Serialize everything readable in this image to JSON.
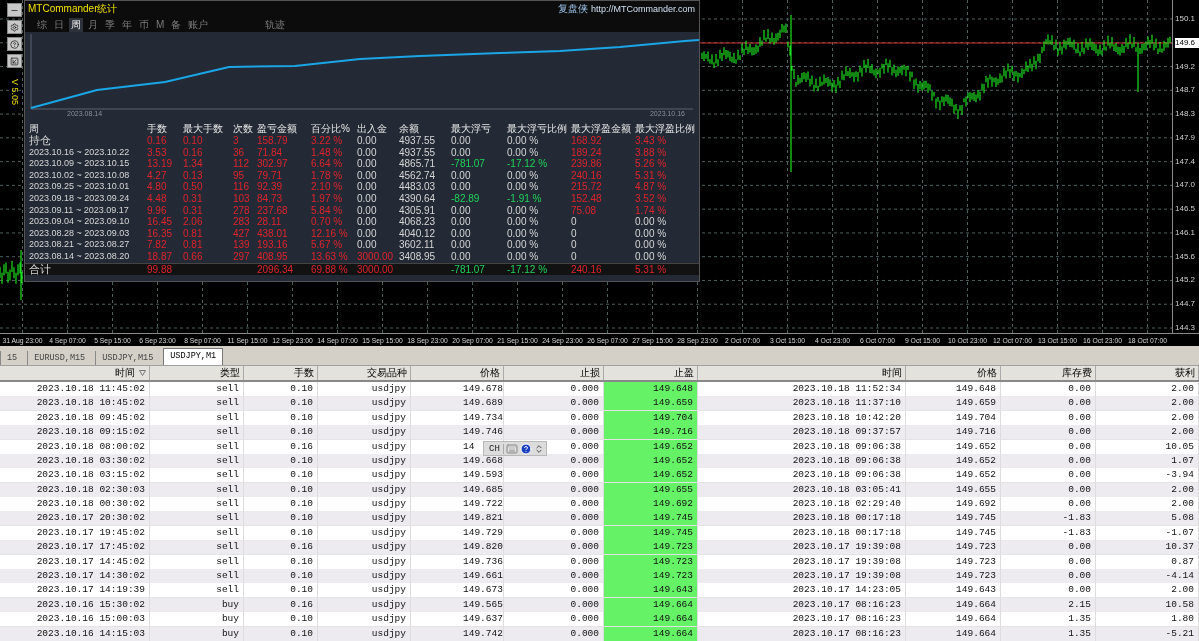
{
  "chart": {
    "price_ticks": [
      {
        "label": "150.1",
        "current": false
      },
      {
        "label": "149.6",
        "current": true
      },
      {
        "label": "149.2",
        "current": false
      },
      {
        "label": "148.7",
        "current": false
      },
      {
        "label": "148.3",
        "current": false
      },
      {
        "label": "147.9",
        "current": false
      },
      {
        "label": "147.4",
        "current": false
      },
      {
        "label": "147.0",
        "current": false
      },
      {
        "label": "146.5",
        "current": false
      },
      {
        "label": "146.1",
        "current": false
      },
      {
        "label": "145.6",
        "current": false
      },
      {
        "label": "145.2",
        "current": false
      },
      {
        "label": "144.7",
        "current": false
      },
      {
        "label": "144.3",
        "current": false
      }
    ],
    "time_labels": [
      "31 Aug 23:00",
      "4 Sep 07:00",
      "5 Sep 15:00",
      "6 Sep 23:00",
      "8 Sep 07:00",
      "11 Sep 15:00",
      "12 Sep 23:00",
      "14 Sep 07:00",
      "15 Sep 15:00",
      "18 Sep 23:00",
      "20 Sep 07:00",
      "21 Sep 15:00",
      "24 Sep 23:00",
      "26 Sep 07:00",
      "27 Sep 15:00",
      "28 Sep 23:00",
      "2 Oct 07:00",
      "3 Oct 15:00",
      "4 Oct 23:00",
      "6 Oct 07:00",
      "9 Oct 15:00",
      "10 Oct 23:00",
      "12 Oct 07:00",
      "13 Oct 15:00",
      "16 Oct 23:00",
      "18 Oct 07:00"
    ]
  },
  "stats_window": {
    "title": "MTCommander统计",
    "brand": "复盘侠",
    "url": "http://MTCommander.com",
    "version": "V 5.05",
    "tabs": [
      {
        "label": "综",
        "selected": false
      },
      {
        "label": "日",
        "selected": false
      },
      {
        "label": "周",
        "selected": true
      },
      {
        "label": "月",
        "selected": false
      },
      {
        "label": "季",
        "selected": false
      },
      {
        "label": "年",
        "selected": false
      },
      {
        "label": "币",
        "selected": false
      },
      {
        "label": "M",
        "selected": false
      },
      {
        "label": "备",
        "selected": false
      },
      {
        "label": "账户",
        "selected": false
      },
      {
        "label": "轨迹",
        "selected": false
      }
    ],
    "chart_start": "2023.08.14",
    "chart_end": "2023.10.16",
    "columns": [
      "周",
      "手数",
      "最大手数",
      "次数",
      "盈亏金额",
      "百分比%",
      "出入金",
      "余额",
      "最大浮亏",
      "最大浮亏比例",
      "最大浮盈金额",
      "最大浮盈比例"
    ],
    "rows": [
      {
        "kind": "holding",
        "floating_loss": false,
        "deposit": false,
        "floating_profit": true,
        "cells": [
          "持仓",
          "0.16",
          "0.10",
          "3",
          "158.79",
          "3.22 %",
          "0.00",
          "4937.55",
          "0.00",
          "0.00 %",
          "168.92",
          "3.43 %"
        ]
      },
      {
        "kind": "period",
        "floating_loss": false,
        "deposit": false,
        "floating_profit": true,
        "cells": [
          "2023.10.16 ~ 2023.10.22",
          "3.53",
          "0.16",
          "36",
          "71.84",
          "1.48 %",
          "0.00",
          "4937.55",
          "0.00",
          "0.00 %",
          "189.24",
          "3.88 %"
        ]
      },
      {
        "kind": "period",
        "floating_loss": true,
        "deposit": false,
        "floating_profit": true,
        "cells": [
          "2023.10.09 ~ 2023.10.15",
          "13.19",
          "1.34",
          "112",
          "302.97",
          "6.64 %",
          "0.00",
          "4865.71",
          "-781.07",
          "-17.12 %",
          "239.86",
          "5.26 %"
        ]
      },
      {
        "kind": "period",
        "floating_loss": false,
        "deposit": false,
        "floating_profit": true,
        "cells": [
          "2023.10.02 ~ 2023.10.08",
          "4.27",
          "0.13",
          "95",
          "79.71",
          "1.78 %",
          "0.00",
          "4562.74",
          "0.00",
          "0.00 %",
          "240.16",
          "5.31 %"
        ]
      },
      {
        "kind": "period",
        "floating_loss": false,
        "deposit": false,
        "floating_profit": true,
        "cells": [
          "2023.09.25 ~ 2023.10.01",
          "4.80",
          "0.50",
          "116",
          "92.39",
          "2.10 %",
          "0.00",
          "4483.03",
          "0.00",
          "0.00 %",
          "215.72",
          "4.87 %"
        ]
      },
      {
        "kind": "period",
        "floating_loss": true,
        "deposit": false,
        "floating_profit": true,
        "cells": [
          "2023.09.18 ~ 2023.09.24",
          "4.48",
          "0.31",
          "103",
          "84.73",
          "1.97 %",
          "0.00",
          "4390.64",
          "-82.89",
          "-1.91 %",
          "152.48",
          "3.52 %"
        ]
      },
      {
        "kind": "period",
        "floating_loss": false,
        "deposit": false,
        "floating_profit": true,
        "cells": [
          "2023.09.11 ~ 2023.09.17",
          "9.96",
          "0.31",
          "278",
          "237.68",
          "5.84 %",
          "0.00",
          "4305.91",
          "0.00",
          "0.00 %",
          "75.08",
          "1.74 %"
        ]
      },
      {
        "kind": "period",
        "floating_loss": false,
        "deposit": false,
        "floating_profit": false,
        "cells": [
          "2023.09.04 ~ 2023.09.10",
          "16.45",
          "2.06",
          "283",
          "28.11",
          "0.70 %",
          "0.00",
          "4068.23",
          "0.00",
          "0.00 %",
          "0",
          "0.00 %"
        ]
      },
      {
        "kind": "period",
        "floating_loss": false,
        "deposit": false,
        "floating_profit": false,
        "cells": [
          "2023.08.28 ~ 2023.09.03",
          "16.35",
          "0.81",
          "427",
          "438.01",
          "12.16 %",
          "0.00",
          "4040.12",
          "0.00",
          "0.00 %",
          "0",
          "0.00 %"
        ]
      },
      {
        "kind": "period",
        "floating_loss": false,
        "deposit": false,
        "floating_profit": false,
        "cells": [
          "2023.08.21 ~ 2023.08.27",
          "7.82",
          "0.81",
          "139",
          "193.16",
          "5.67 %",
          "0.00",
          "3602.11",
          "0.00",
          "0.00 %",
          "0",
          "0.00 %"
        ]
      },
      {
        "kind": "period",
        "floating_loss": false,
        "deposit": true,
        "floating_profit": false,
        "cells": [
          "2023.08.14 ~ 2023.08.20",
          "18.87",
          "0.66",
          "297",
          "408.95",
          "13.63 %",
          "3000.00",
          "3408.95",
          "0.00",
          "0.00 %",
          "0",
          "0.00 %"
        ]
      },
      {
        "kind": "total",
        "floating_loss": true,
        "deposit": true,
        "floating_profit": true,
        "cells": [
          "合计",
          "99.88",
          null,
          null,
          "2096.34",
          "69.88 %",
          "3000.00",
          null,
          "-781.07",
          "-17.12 %",
          "240.16",
          "5.31 %"
        ]
      }
    ]
  },
  "terminal": {
    "tabs": [
      {
        "label": "15",
        "selected": false
      },
      {
        "label": "EURUSD,M15",
        "selected": false
      },
      {
        "label": "USDJPY,M15",
        "selected": false
      },
      {
        "label": "USDJPY,M1",
        "selected": true
      }
    ],
    "columns": [
      {
        "label": "时间",
        "sorted": true
      },
      {
        "label": "类型",
        "sorted": false
      },
      {
        "label": "手数",
        "sorted": false
      },
      {
        "label": "交易品种",
        "sorted": false
      },
      {
        "label": "价格",
        "sorted": false
      },
      {
        "label": "止损",
        "sorted": false
      },
      {
        "label": "止盈",
        "sorted": false
      },
      {
        "label": "时间",
        "sorted": false
      },
      {
        "label": "价格",
        "sorted": false
      },
      {
        "label": "库存费",
        "sorted": false
      },
      {
        "label": "获利",
        "sorted": false
      }
    ],
    "rows": [
      [
        "2023.10.18 11:45:02",
        "sell",
        "0.10",
        "usdjpy",
        "149.678",
        "0.000",
        "149.648",
        "2023.10.18 11:52:34",
        "149.648",
        "0.00",
        "2.00"
      ],
      [
        "2023.10.18 10:45:02",
        "sell",
        "0.10",
        "usdjpy",
        "149.689",
        "0.000",
        "149.659",
        "2023.10.18 11:37:10",
        "149.659",
        "0.00",
        "2.00"
      ],
      [
        "2023.10.18 09:45:02",
        "sell",
        "0.10",
        "usdjpy",
        "149.734",
        "0.000",
        "149.704",
        "2023.10.18 10:42:20",
        "149.704",
        "0.00",
        "2.00"
      ],
      [
        "2023.10.18 09:15:02",
        "sell",
        "0.10",
        "usdjpy",
        "149.746",
        "0.000",
        "149.716",
        "2023.10.18 09:37:57",
        "149.716",
        "0.00",
        "2.00"
      ],
      [
        "2023.10.18 08:00:02",
        "sell",
        "0.16",
        "usdjpy",
        "14",
        "0.000",
        "149.652",
        "2023.10.18 09:06:38",
        "149.652",
        "0.00",
        "10.05"
      ],
      [
        "2023.10.18 03:30:02",
        "sell",
        "0.10",
        "usdjpy",
        "149.668",
        "0.000",
        "149.652",
        "2023.10.18 09:06:38",
        "149.652",
        "0.00",
        "1.07"
      ],
      [
        "2023.10.18 03:15:02",
        "sell",
        "0.10",
        "usdjpy",
        "149.593",
        "0.000",
        "149.652",
        "2023.10.18 09:06:38",
        "149.652",
        "0.00",
        "-3.94"
      ],
      [
        "2023.10.18 02:30:03",
        "sell",
        "0.10",
        "usdjpy",
        "149.685",
        "0.000",
        "149.655",
        "2023.10.18 03:05:41",
        "149.655",
        "0.00",
        "2.00"
      ],
      [
        "2023.10.18 00:30:02",
        "sell",
        "0.10",
        "usdjpy",
        "149.722",
        "0.000",
        "149.692",
        "2023.10.18 02:29:40",
        "149.692",
        "0.00",
        "2.00"
      ],
      [
        "2023.10.17 20:30:02",
        "sell",
        "0.10",
        "usdjpy",
        "149.821",
        "0.000",
        "149.745",
        "2023.10.18 00:17:18",
        "149.745",
        "-1.83",
        "5.08"
      ],
      [
        "2023.10.17 19:45:02",
        "sell",
        "0.10",
        "usdjpy",
        "149.729",
        "0.000",
        "149.745",
        "2023.10.18 00:17:18",
        "149.745",
        "-1.83",
        "-1.07"
      ],
      [
        "2023.10.17 17:45:02",
        "sell",
        "0.16",
        "usdjpy",
        "149.820",
        "0.000",
        "149.723",
        "2023.10.17 19:39:08",
        "149.723",
        "0.00",
        "10.37"
      ],
      [
        "2023.10.17 14:45:02",
        "sell",
        "0.10",
        "usdjpy",
        "149.736",
        "0.000",
        "149.723",
        "2023.10.17 19:39:08",
        "149.723",
        "0.00",
        "0.87"
      ],
      [
        "2023.10.17 14:30:02",
        "sell",
        "0.10",
        "usdjpy",
        "149.661",
        "0.000",
        "149.723",
        "2023.10.17 19:39:08",
        "149.723",
        "0.00",
        "-4.14"
      ],
      [
        "2023.10.17 14:19:39",
        "sell",
        "0.10",
        "usdjpy",
        "149.673",
        "0.000",
        "149.643",
        "2023.10.17 14:23:05",
        "149.643",
        "0.00",
        "2.00"
      ],
      [
        "2023.10.16 15:30:02",
        "buy",
        "0.16",
        "usdjpy",
        "149.565",
        "0.000",
        "149.664",
        "2023.10.17 08:16:23",
        "149.664",
        "2.15",
        "10.58"
      ],
      [
        "2023.10.16 15:00:03",
        "buy",
        "0.10",
        "usdjpy",
        "149.637",
        "0.000",
        "149.664",
        "2023.10.17 08:16:23",
        "149.664",
        "1.35",
        "1.80"
      ],
      [
        "2023.10.16 14:15:03",
        "buy",
        "0.10",
        "usdjpy",
        "149.742",
        "0.000",
        "149.664",
        "2023.10.17 08:16:23",
        "149.664",
        "1.35",
        "-5.21"
      ]
    ]
  },
  "ime_toolbar": {
    "label": "CH"
  }
}
